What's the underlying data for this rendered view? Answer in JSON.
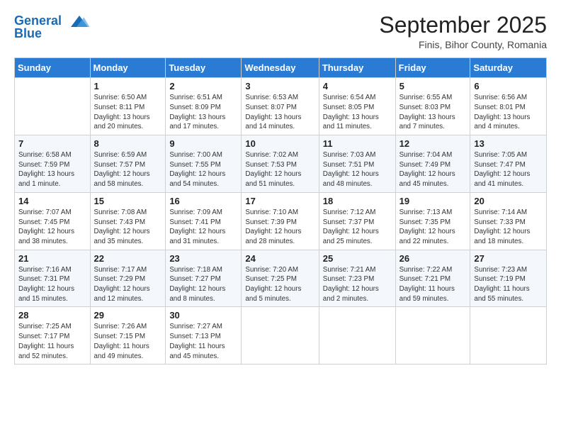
{
  "header": {
    "logo_line1": "General",
    "logo_line2": "Blue",
    "month": "September 2025",
    "location": "Finis, Bihor County, Romania"
  },
  "weekdays": [
    "Sunday",
    "Monday",
    "Tuesday",
    "Wednesday",
    "Thursday",
    "Friday",
    "Saturday"
  ],
  "weeks": [
    [
      {
        "num": "",
        "detail": ""
      },
      {
        "num": "1",
        "detail": "Sunrise: 6:50 AM\nSunset: 8:11 PM\nDaylight: 13 hours\nand 20 minutes."
      },
      {
        "num": "2",
        "detail": "Sunrise: 6:51 AM\nSunset: 8:09 PM\nDaylight: 13 hours\nand 17 minutes."
      },
      {
        "num": "3",
        "detail": "Sunrise: 6:53 AM\nSunset: 8:07 PM\nDaylight: 13 hours\nand 14 minutes."
      },
      {
        "num": "4",
        "detail": "Sunrise: 6:54 AM\nSunset: 8:05 PM\nDaylight: 13 hours\nand 11 minutes."
      },
      {
        "num": "5",
        "detail": "Sunrise: 6:55 AM\nSunset: 8:03 PM\nDaylight: 13 hours\nand 7 minutes."
      },
      {
        "num": "6",
        "detail": "Sunrise: 6:56 AM\nSunset: 8:01 PM\nDaylight: 13 hours\nand 4 minutes."
      }
    ],
    [
      {
        "num": "7",
        "detail": "Sunrise: 6:58 AM\nSunset: 7:59 PM\nDaylight: 13 hours\nand 1 minute."
      },
      {
        "num": "8",
        "detail": "Sunrise: 6:59 AM\nSunset: 7:57 PM\nDaylight: 12 hours\nand 58 minutes."
      },
      {
        "num": "9",
        "detail": "Sunrise: 7:00 AM\nSunset: 7:55 PM\nDaylight: 12 hours\nand 54 minutes."
      },
      {
        "num": "10",
        "detail": "Sunrise: 7:02 AM\nSunset: 7:53 PM\nDaylight: 12 hours\nand 51 minutes."
      },
      {
        "num": "11",
        "detail": "Sunrise: 7:03 AM\nSunset: 7:51 PM\nDaylight: 12 hours\nand 48 minutes."
      },
      {
        "num": "12",
        "detail": "Sunrise: 7:04 AM\nSunset: 7:49 PM\nDaylight: 12 hours\nand 45 minutes."
      },
      {
        "num": "13",
        "detail": "Sunrise: 7:05 AM\nSunset: 7:47 PM\nDaylight: 12 hours\nand 41 minutes."
      }
    ],
    [
      {
        "num": "14",
        "detail": "Sunrise: 7:07 AM\nSunset: 7:45 PM\nDaylight: 12 hours\nand 38 minutes."
      },
      {
        "num": "15",
        "detail": "Sunrise: 7:08 AM\nSunset: 7:43 PM\nDaylight: 12 hours\nand 35 minutes."
      },
      {
        "num": "16",
        "detail": "Sunrise: 7:09 AM\nSunset: 7:41 PM\nDaylight: 12 hours\nand 31 minutes."
      },
      {
        "num": "17",
        "detail": "Sunrise: 7:10 AM\nSunset: 7:39 PM\nDaylight: 12 hours\nand 28 minutes."
      },
      {
        "num": "18",
        "detail": "Sunrise: 7:12 AM\nSunset: 7:37 PM\nDaylight: 12 hours\nand 25 minutes."
      },
      {
        "num": "19",
        "detail": "Sunrise: 7:13 AM\nSunset: 7:35 PM\nDaylight: 12 hours\nand 22 minutes."
      },
      {
        "num": "20",
        "detail": "Sunrise: 7:14 AM\nSunset: 7:33 PM\nDaylight: 12 hours\nand 18 minutes."
      }
    ],
    [
      {
        "num": "21",
        "detail": "Sunrise: 7:16 AM\nSunset: 7:31 PM\nDaylight: 12 hours\nand 15 minutes."
      },
      {
        "num": "22",
        "detail": "Sunrise: 7:17 AM\nSunset: 7:29 PM\nDaylight: 12 hours\nand 12 minutes."
      },
      {
        "num": "23",
        "detail": "Sunrise: 7:18 AM\nSunset: 7:27 PM\nDaylight: 12 hours\nand 8 minutes."
      },
      {
        "num": "24",
        "detail": "Sunrise: 7:20 AM\nSunset: 7:25 PM\nDaylight: 12 hours\nand 5 minutes."
      },
      {
        "num": "25",
        "detail": "Sunrise: 7:21 AM\nSunset: 7:23 PM\nDaylight: 12 hours\nand 2 minutes."
      },
      {
        "num": "26",
        "detail": "Sunrise: 7:22 AM\nSunset: 7:21 PM\nDaylight: 11 hours\nand 59 minutes."
      },
      {
        "num": "27",
        "detail": "Sunrise: 7:23 AM\nSunset: 7:19 PM\nDaylight: 11 hours\nand 55 minutes."
      }
    ],
    [
      {
        "num": "28",
        "detail": "Sunrise: 7:25 AM\nSunset: 7:17 PM\nDaylight: 11 hours\nand 52 minutes."
      },
      {
        "num": "29",
        "detail": "Sunrise: 7:26 AM\nSunset: 7:15 PM\nDaylight: 11 hours\nand 49 minutes."
      },
      {
        "num": "30",
        "detail": "Sunrise: 7:27 AM\nSunset: 7:13 PM\nDaylight: 11 hours\nand 45 minutes."
      },
      {
        "num": "",
        "detail": ""
      },
      {
        "num": "",
        "detail": ""
      },
      {
        "num": "",
        "detail": ""
      },
      {
        "num": "",
        "detail": ""
      }
    ]
  ]
}
